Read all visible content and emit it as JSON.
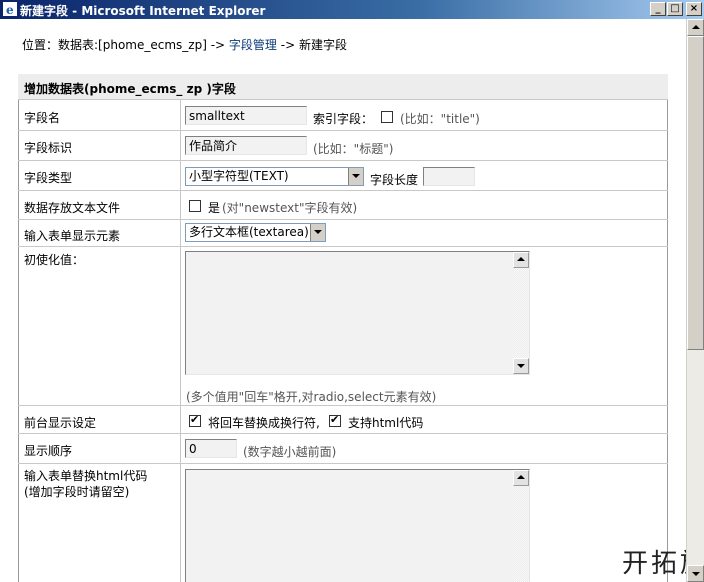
{
  "window": {
    "title": "新建字段 - Microsoft Internet Explorer"
  },
  "breadcrumb": {
    "prefix": "位置：数据表:[phome_ecms_zp] ->",
    "link": "字段管理",
    "suffix": "-> 新建字段"
  },
  "form": {
    "header": "增加数据表(phome_ecms_ zp )字段",
    "field_name": {
      "label": "字段名",
      "value": "smalltext",
      "index_label": "索引字段：",
      "index_hint": "(比如：\"title\")",
      "index_checked": false
    },
    "field_title": {
      "label": "字段标识",
      "value": "作品简介",
      "hint": "(比如：\"标题\")"
    },
    "field_type": {
      "label": "字段类型",
      "selected": "小型字符型(TEXT)",
      "length_label": "字段长度",
      "length_value": ""
    },
    "text_file": {
      "label": "数据存放文本文件",
      "option_label": "是",
      "hint": "(对\"newstext\"字段有效)",
      "checked": false
    },
    "form_element": {
      "label": "输入表单显示元素",
      "selected": "多行文本框(textarea)"
    },
    "initial_value": {
      "label": "初使化值：",
      "value": "",
      "hint": "(多个值用\"回车\"格开,对radio,select元素有效)"
    },
    "frontend": {
      "label": "前台显示设定",
      "option1": "将回车替换成换行符,",
      "option1_checked": true,
      "option2": "支持html代码",
      "option2_checked": true
    },
    "order": {
      "label": "显示顺序",
      "value": "0",
      "hint": "(数字越小越前面)"
    },
    "replace_html": {
      "label": "输入表单替换html代码",
      "label2": "(增加字段时请留空)",
      "value": ""
    }
  },
  "watermark": "开拓族"
}
